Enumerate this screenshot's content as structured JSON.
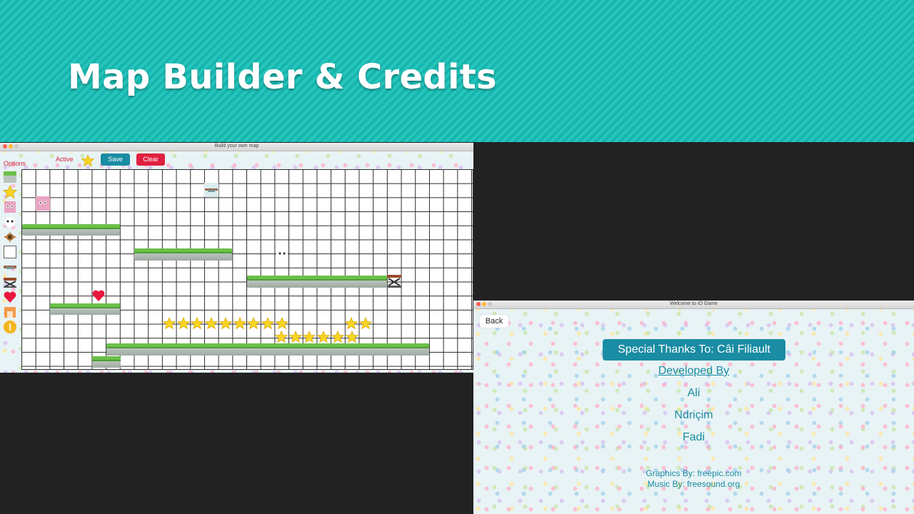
{
  "slide": {
    "title": "Map Builder & Credits"
  },
  "colors": {
    "teal": "#1a8ca3",
    "red": "#e02040",
    "header_teal": "#1fbdb4"
  },
  "builder": {
    "window_title": "Build your own map",
    "options_label": "Options",
    "active_label": "Active",
    "active_tile": "star-tile",
    "save_label": "Save",
    "clear_label": "Clear",
    "palette": [
      "grass-platform-tile",
      "star-tile",
      "pink-cube-enemy-tile",
      "white-ghost-enemy-tile",
      "spiky-brown-enemy-tile",
      "empty-block-tile",
      "floating-log-tile",
      "spring-trampoline-tile",
      "heart-tile",
      "orange-exit-door-tile",
      "gold-coin-tile"
    ],
    "grid": {
      "columns": 32,
      "rows": 14
    }
  },
  "credits": {
    "window_title": "Welcome to iO Game",
    "back_label": "Back",
    "special_thanks": "Special Thanks To: Câi Filiault",
    "developed_by_label": "Developed By",
    "developers": [
      "Ali",
      "Ndriçim",
      "Fadi"
    ],
    "graphics_credit": "Graphics By: freepic.com",
    "music_credit": "Music By: freesound.org"
  }
}
